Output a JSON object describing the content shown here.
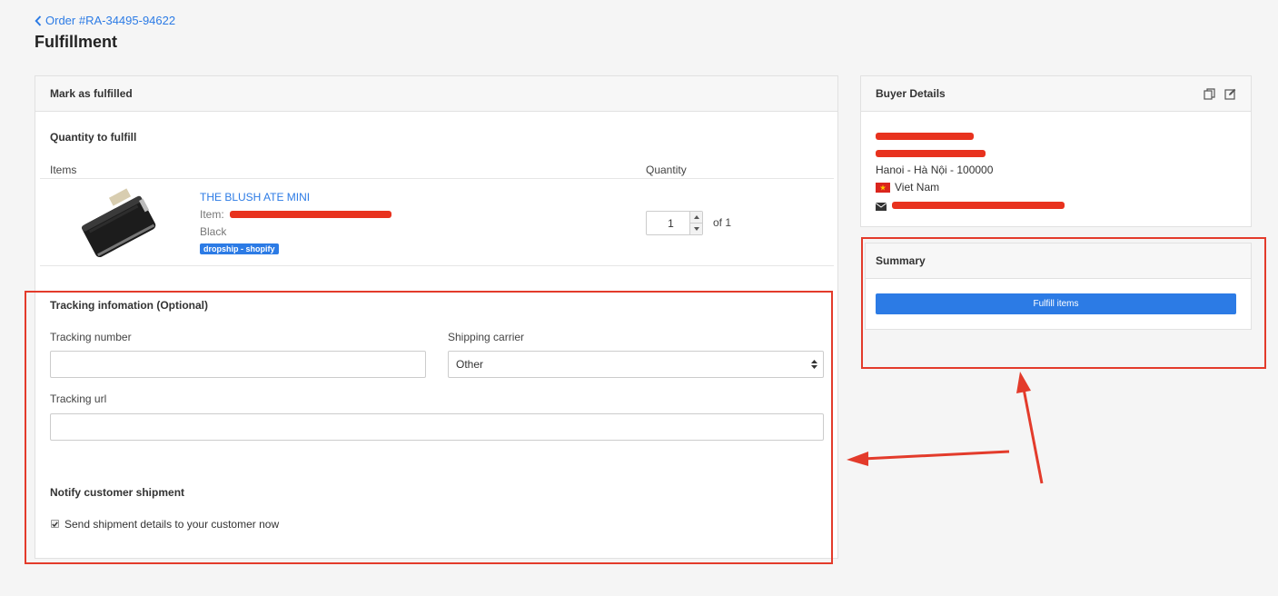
{
  "header": {
    "back_link": "Order #RA-34495-94622",
    "title": "Fulfillment"
  },
  "main_card": {
    "title": "Mark as fulfilled",
    "quantity_section_title": "Quantity to fulfill",
    "columns": {
      "items": "Items",
      "quantity": "Quantity"
    },
    "product": {
      "name": "THE BLUSH ATE MINI",
      "item_label": "Item:",
      "variant": "Black",
      "tag": "dropship - shopify",
      "quantity": "1",
      "quantity_total": "of 1"
    },
    "tracking": {
      "title": "Tracking infomation (Optional)",
      "number_label": "Tracking number",
      "number_value": "",
      "carrier_label": "Shipping carrier",
      "carrier_value": "Other",
      "url_label": "Tracking url",
      "url_value": ""
    },
    "notify": {
      "title": "Notify customer shipment",
      "checkbox_label": "Send shipment details to your customer now",
      "checked": true
    }
  },
  "buyer_card": {
    "title": "Buyer Details",
    "address_city": "Hanoi - Hà Nội - 100000",
    "country": "Viet Nam"
  },
  "summary_card": {
    "title": "Summary",
    "fulfill_button": "Fulfill items"
  },
  "colors": {
    "accent": "#2c7be5",
    "annotation_red": "#e33b2b",
    "redaction_red": "#e8321e"
  },
  "icons": [
    "chevron-left-icon",
    "copy-icon",
    "edit-icon",
    "vietnam-flag-icon",
    "envelope-icon",
    "select-arrows-icon",
    "check-icon"
  ]
}
